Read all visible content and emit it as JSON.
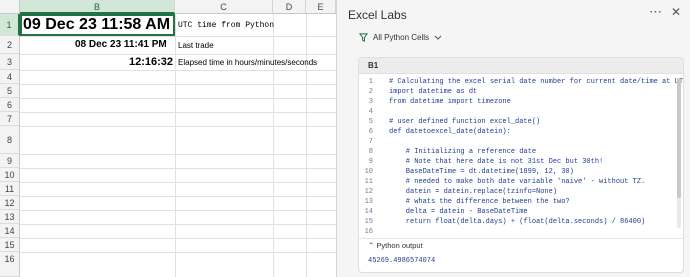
{
  "sheet": {
    "columns": [
      "B",
      "C",
      "D",
      "E"
    ],
    "rows": [
      "1",
      "2",
      "3",
      "4",
      "5",
      "6",
      "7",
      "8",
      "9",
      "10",
      "11",
      "12",
      "13",
      "14",
      "15",
      "16"
    ],
    "cells": {
      "b1": "09 Dec 23 11:58 AM",
      "c1": "UTC time from Python",
      "b2": "08 Dec 23 11:41 PM",
      "c2": "Last trade",
      "b3": "12:16:32",
      "c3": "Elapsed time in hours/minutes/seconds"
    }
  },
  "pane": {
    "title": "Excel Labs",
    "more_icon": "ellipsis-icon",
    "close_icon": "close-icon",
    "filter": {
      "label": "All Python Cells",
      "icon": "filter-icon"
    },
    "card": {
      "cell_ref": "B1",
      "code": [
        {
          "n": "1",
          "t": "# Calculating the excel serial date number for current date/time at UTC"
        },
        {
          "n": "2",
          "t": "import datetime as dt"
        },
        {
          "n": "3",
          "t": "from datetime import timezone"
        },
        {
          "n": "4",
          "t": ""
        },
        {
          "n": "5",
          "t": "# user defined function excel_date()"
        },
        {
          "n": "6",
          "t": "def datetoexcel_date(datein):"
        },
        {
          "n": "7",
          "t": ""
        },
        {
          "n": "8",
          "t": "    # Initializing a reference date"
        },
        {
          "n": "9",
          "t": "    # Note that here date is not 31st Dec but 30th!"
        },
        {
          "n": "10",
          "t": "    BaseDateTime = dt.datetime(1899, 12, 30)"
        },
        {
          "n": "11",
          "t": "    # needed to make both date variable 'naive' - without TZ."
        },
        {
          "n": "12",
          "t": "    datein = datein.replace(tzinfo=None)"
        },
        {
          "n": "13",
          "t": "    # whats the difference between the two?"
        },
        {
          "n": "14",
          "t": "    delta = datein - BaseDateTime"
        },
        {
          "n": "15",
          "t": "    return float(delta.days) + (float(delta.seconds) / 86400)"
        },
        {
          "n": "16",
          "t": ""
        }
      ],
      "output_label": "Python output",
      "output_value": "45269.4986574074"
    }
  }
}
